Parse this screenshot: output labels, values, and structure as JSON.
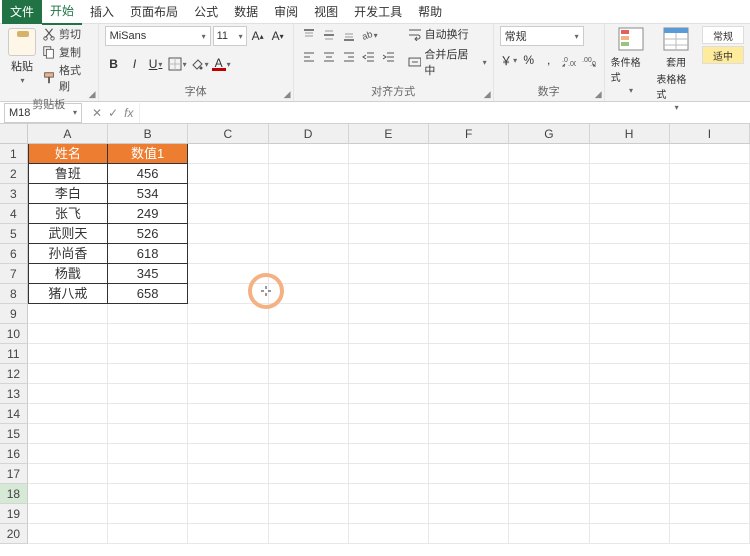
{
  "menu": {
    "file": "文件",
    "home": "开始",
    "insert": "插入",
    "layout": "页面布局",
    "formulas": "公式",
    "data": "数据",
    "review": "审阅",
    "view": "视图",
    "dev": "开发工具",
    "help": "帮助"
  },
  "ribbon": {
    "clipboard": {
      "paste": "粘贴",
      "cut": "剪切",
      "copy": "复制",
      "painter": "格式刷",
      "label": "剪贴板"
    },
    "font": {
      "name": "MiSans",
      "size": "11",
      "label": "字体",
      "B": "B",
      "I": "I",
      "U": "U",
      "A": "A"
    },
    "align": {
      "label": "对齐方式",
      "wrap": "自动换行",
      "merge": "合并后居中"
    },
    "number": {
      "label": "数字",
      "format": "常规",
      "percent": "%",
      "comma": ",",
      "currency": "￥"
    },
    "styles": {
      "cond": "条件格式",
      "table": "套用",
      "table2": "表格格式",
      "normal": "常规",
      "good": "适中"
    }
  },
  "namebox": "M18",
  "cols": [
    "A",
    "B",
    "C",
    "D",
    "E",
    "F",
    "G",
    "H",
    "I"
  ],
  "rows": 20,
  "selectedRow": 18,
  "table": {
    "headers": [
      "姓名",
      "数值1"
    ],
    "data": [
      [
        "鲁班",
        "456"
      ],
      [
        "李白",
        "534"
      ],
      [
        "张飞",
        "249"
      ],
      [
        "武则天",
        "526"
      ],
      [
        "孙尚香",
        "618"
      ],
      [
        "杨戬",
        "345"
      ],
      [
        "猪八戒",
        "658"
      ]
    ]
  }
}
